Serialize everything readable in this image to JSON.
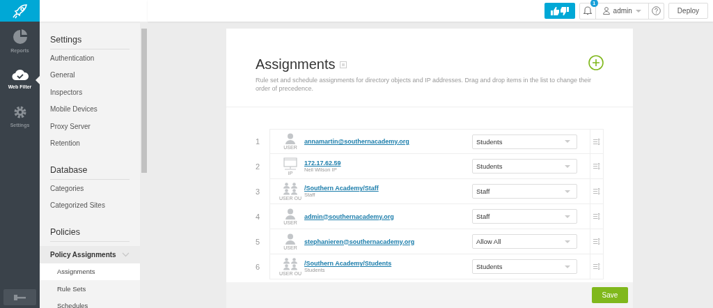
{
  "topbar": {
    "notifications": {
      "count": "1"
    },
    "user": {
      "name": "admin"
    },
    "deploy": "Deploy"
  },
  "rail": [
    {
      "kind": "reports",
      "label": "Reports",
      "selected": false
    },
    {
      "kind": "webfilter",
      "label": "Web Filter",
      "selected": true
    },
    {
      "kind": "settings",
      "label": "Settings",
      "selected": false
    }
  ],
  "sidebar": {
    "sections": [
      {
        "title": "Settings",
        "items": [
          {
            "label": "Authentication",
            "selected": false
          },
          {
            "label": "General",
            "selected": false
          },
          {
            "label": "Inspectors",
            "selected": false
          },
          {
            "label": "Mobile Devices",
            "selected": false
          },
          {
            "label": "Proxy Server",
            "selected": false
          },
          {
            "label": "Retention",
            "selected": false
          }
        ]
      },
      {
        "title": "Database",
        "items": [
          {
            "label": "Categories",
            "selected": false
          },
          {
            "label": "Categorized Sites",
            "selected": false
          }
        ]
      },
      {
        "title": "Policies",
        "items": [
          {
            "label": "Policy Assignments",
            "selected": false,
            "expanded": true,
            "children": [
              {
                "label": "Assignments",
                "selected": true
              },
              {
                "label": "Rule Sets",
                "selected": false
              },
              {
                "label": "Schedules",
                "selected": false
              }
            ]
          }
        ]
      }
    ]
  },
  "page": {
    "title": "Assignments",
    "description": "Rule set and schedule assignments for directory objects and IP addresses. Drag and drop items in the list to change their order of precedence.",
    "assignments": [
      {
        "number": "1",
        "kind": "user",
        "type_label": "USER",
        "name": "annamartin@southernacademy.org",
        "ruleset": "Students"
      },
      {
        "number": "2",
        "kind": "ip",
        "type_label": "IP",
        "name": "172.17.62.59",
        "subtitle": "Neil Wilson IP",
        "ruleset": "Students"
      },
      {
        "number": "3",
        "kind": "group",
        "type_label": "USER OU",
        "name": "/Southern Academy/Staff",
        "subtitle": "Staff",
        "ruleset": "Staff"
      },
      {
        "number": "4",
        "kind": "user",
        "type_label": "USER",
        "name": "admin@southernacademy.org",
        "ruleset": "Staff"
      },
      {
        "number": "5",
        "kind": "user",
        "type_label": "USER",
        "name": "stephanieren@southernacademy.org",
        "ruleset": "Allow All"
      },
      {
        "number": "6",
        "kind": "group",
        "type_label": "USER OU",
        "name": "/Southern Academy/Students",
        "subtitle": "Students",
        "ruleset": "Students"
      }
    ],
    "save": "Save"
  }
}
